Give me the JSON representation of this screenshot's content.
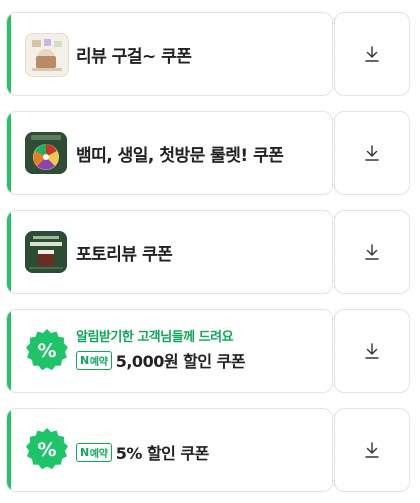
{
  "coupons": [
    {
      "title": "리뷰 구걸~ 쿠폰",
      "thumb": "review-beg-thumbnail"
    },
    {
      "title": "뱀띠, 생일, 첫방문 룰렛! 쿠폰",
      "thumb": "roulette-thumbnail"
    },
    {
      "title": "포토리뷰 쿠폰",
      "thumb": "photo-review-thumbnail"
    },
    {
      "subtitle": "알림받기한 고객님들께 드려요",
      "badge_n": "N",
      "badge_text": "예약",
      "title": "5,000원 할인 쿠폰",
      "icon": "percent-badge-icon"
    },
    {
      "badge_n": "N",
      "badge_text": "예약",
      "title": "5% 할인 쿠폰",
      "icon": "percent-badge-icon"
    }
  ],
  "colors": {
    "accent": "#22c46a",
    "green_text": "#10a85a"
  },
  "download_icon": "download-icon"
}
